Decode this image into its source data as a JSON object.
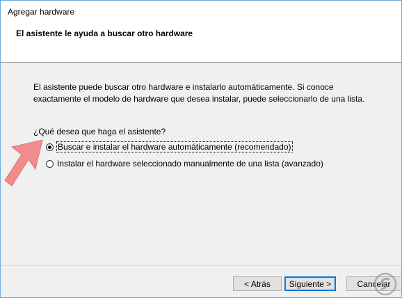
{
  "window": {
    "title": "Agregar hardware"
  },
  "header": {
    "title": "El asistente le ayuda a buscar otro hardware"
  },
  "body": {
    "description": "El asistente puede buscar otro hardware e instalarlo automáticamente. Si conoce exactamente el modelo de hardware que desea instalar, puede seleccionarlo de una lista.",
    "question": "¿Qué desea que haga el asistente?",
    "options": [
      {
        "label": "Buscar e instalar el hardware automáticamente (recomendado)",
        "selected": true
      },
      {
        "label": "Instalar el hardware seleccionado manualmente de una lista (avanzado)",
        "selected": false
      }
    ]
  },
  "buttons": {
    "back": "< Atrás",
    "next": "Siguiente >",
    "cancel": "Cancelar"
  },
  "colors": {
    "accent": "#0078d7",
    "arrow": "#f08c8c"
  },
  "icons": {
    "pointer": "pointer-arrow-icon",
    "watermark": "watermark-logo-icon"
  }
}
